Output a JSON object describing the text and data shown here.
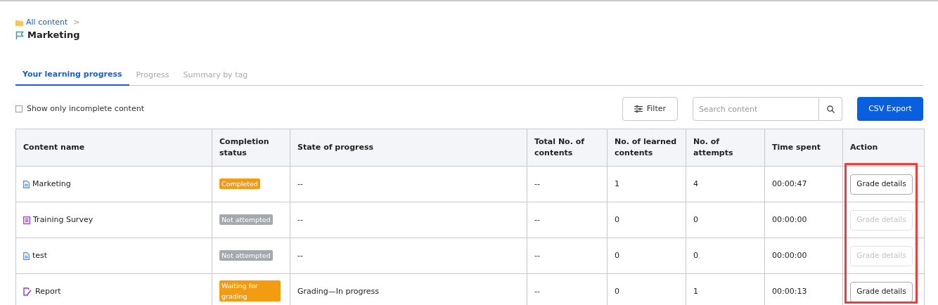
{
  "breadcrumb": {
    "parent": "All content",
    "separator": ">",
    "title": "Marketing"
  },
  "tabs": [
    {
      "label": "Your learning progress",
      "selected": true
    },
    {
      "label": "Progress",
      "selected": false
    },
    {
      "label": "Summary by tag",
      "selected": false
    }
  ],
  "filter_checkbox": {
    "label": "Show only incomplete content",
    "checked": false
  },
  "filter_button": "Filter",
  "search": {
    "placeholder": "Search content"
  },
  "export_button": "CSV Export",
  "table": {
    "columns": [
      "Content name",
      "Completion status",
      "State of progress",
      "Total No. of contents",
      "No. of learned contents",
      "No. of attempts",
      "Time spent",
      "Action"
    ],
    "action_column_highlighted": true,
    "rows": [
      {
        "kind": "document",
        "name": "Marketing",
        "status": "Completed",
        "color": "#f39c12",
        "state": "--",
        "total": "--",
        "learned": "1",
        "attempts": "4",
        "time": "00:00:47",
        "action": "Grade details",
        "disabled": false
      },
      {
        "kind": "survey",
        "name": "Training Survey",
        "status": "Not attempted",
        "color": "#a4a9ae",
        "state": "--",
        "total": "--",
        "learned": "0",
        "attempts": "0",
        "time": "00:00:00",
        "action": "Grade details",
        "disabled": true
      },
      {
        "kind": "document",
        "name": "test",
        "status": "Not attempted",
        "color": "#a4a9ae",
        "state": "--",
        "total": "--",
        "learned": "0",
        "attempts": "0",
        "time": "00:00:00",
        "action": "Grade details",
        "disabled": true
      },
      {
        "kind": "report",
        "name": "Report",
        "status": "Waiting for grading",
        "color": "#f39c12",
        "state": "Grading—In progress",
        "total": "--",
        "learned": "0",
        "attempts": "1",
        "time": "00:00:13",
        "action": "Grade details",
        "disabled": false
      }
    ]
  }
}
